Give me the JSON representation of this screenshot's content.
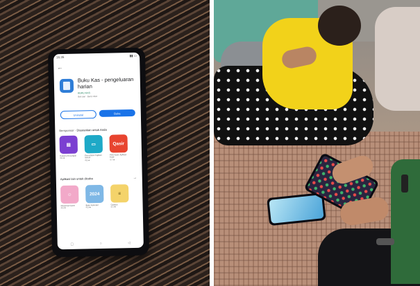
{
  "left_photo": {
    "phone_screen": {
      "status_time": "16.35",
      "app": {
        "name": "Buku Kas - pengeluaran harian",
        "developer": "BUKU KAS",
        "meta": "Beli dari   · Berisi iklan",
        "icon": "book-ledger-icon"
      },
      "buttons": {
        "uninstall": "Uninstal",
        "open": "Buka"
      },
      "sponsored_section": {
        "sponsored_label": "Bersponsor",
        "title": "Disarankan untuk Anda",
        "apps": [
          {
            "caption": "Carisma Keuangan",
            "rating": "4.5",
            "color": "#7b3fd1",
            "icon": "shop-icon"
          },
          {
            "caption": "Pencatatan Tagihan Sehari",
            "rating": "4.5",
            "color": "#1ea9c7",
            "icon": "wallet-icon"
          },
          {
            "caption": "POS Kasir: Aplikasi Kasir",
            "rating": "4.7",
            "color": "#e8442f",
            "label": "Qasir"
          }
        ]
      },
      "other_section": {
        "title": "Aplikasi lain untuk dicoba",
        "apps": [
          {
            "caption": "Mewarnai Game",
            "rating": "4.5",
            "color": "#f2a9c9",
            "icon": "cartoon-icon"
          },
          {
            "caption": "Buku Kalender",
            "rating": "4.5",
            "color": "#7fb8e6",
            "label": "2024"
          },
          {
            "caption": "Catatan",
            "rating": "4.4",
            "color": "#f4d36a",
            "icon": "notes-icon"
          }
        ]
      }
    }
  },
  "right_photo": {
    "scene": "people-sitting-on-mat-with-phones",
    "colors": {
      "shirt": "#f2d21a",
      "hijab": "#5fa898",
      "dress": "#111111",
      "mat": "#b88f79"
    }
  }
}
